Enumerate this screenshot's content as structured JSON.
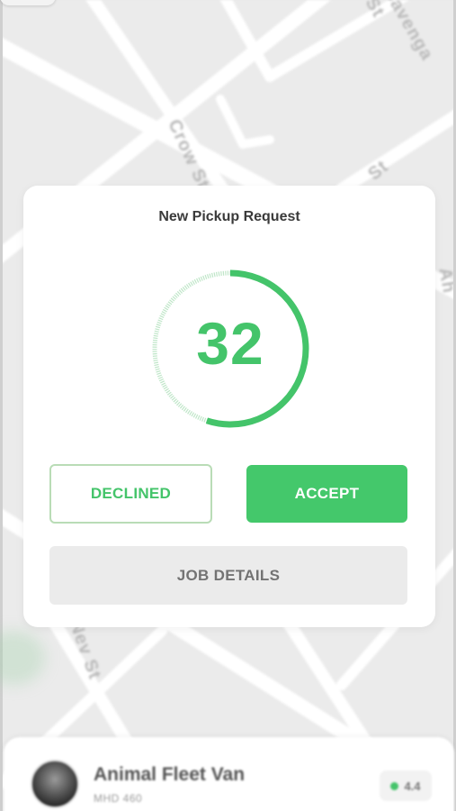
{
  "map": {
    "street_labels": [
      "Cavenga St",
      "Crow St",
      "St",
      "Nev St",
      "Ah"
    ]
  },
  "request_card": {
    "title": "New Pickup Request",
    "countdown": "32",
    "countdown_remaining_fraction": 0.55,
    "accent_color": "#44c46a",
    "decline_label": "DECLINED",
    "accept_label": "ACCEPT",
    "details_label": "JOB DETAILS"
  },
  "vehicle": {
    "name": "Animal Fleet Van",
    "plate": "MHD 460",
    "rating": "4.4",
    "rating_dot_color": "#44c46a",
    "avatar_icon": "vehicle-photo"
  }
}
